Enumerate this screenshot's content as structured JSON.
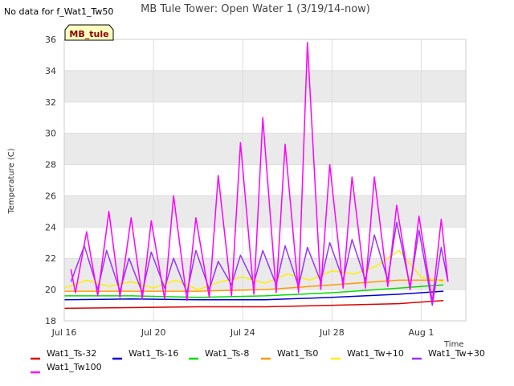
{
  "no_data_note": "No data for f_Wat1_Tw50",
  "badge_label": "MB_tule",
  "colors": {
    "band": "#eaeaea",
    "plot_bg": "#ffffff",
    "badge_fill": "#ffffc0"
  },
  "chart_data": {
    "type": "line",
    "title": "MB Tule Tower: Open Water 1 (3/19/14-now)",
    "xlabel": "Time",
    "ylabel": "Temperature (C)",
    "xlim": [
      "2014-07-16",
      "2014-08-03"
    ],
    "ylim": [
      18,
      36
    ],
    "y_ticks": [
      18,
      20,
      22,
      24,
      26,
      28,
      30,
      32,
      34,
      36
    ],
    "x_ticks": [
      {
        "date": "2014-07-16",
        "label": "Jul 16"
      },
      {
        "date": "2014-07-20",
        "label": "Jul 20"
      },
      {
        "date": "2014-07-24",
        "label": "Jul 24"
      },
      {
        "date": "2014-07-28",
        "label": "Jul 28"
      },
      {
        "date": "2014-08-01",
        "label": "Aug 1"
      }
    ],
    "grid": true,
    "legend_position": "bottom",
    "series": [
      {
        "name": "Wat1_Ts-32",
        "color": "#dd0000",
        "x": [
          "2014-07-16",
          "2014-07-19",
          "2014-07-22",
          "2014-07-25",
          "2014-07-28",
          "2014-07-31",
          "2014-08-02"
        ],
        "y": [
          18.8,
          18.85,
          18.9,
          18.9,
          19.0,
          19.1,
          19.3
        ]
      },
      {
        "name": "Wat1_Ts-16",
        "color": "#0000cc",
        "x": [
          "2014-07-16",
          "2014-07-19",
          "2014-07-22",
          "2014-07-25",
          "2014-07-28",
          "2014-07-31",
          "2014-08-02"
        ],
        "y": [
          19.35,
          19.4,
          19.35,
          19.35,
          19.5,
          19.7,
          19.9
        ]
      },
      {
        "name": "Wat1_Ts-8",
        "color": "#00dd00",
        "x": [
          "2014-07-16",
          "2014-07-19",
          "2014-07-22",
          "2014-07-25",
          "2014-07-28",
          "2014-07-31",
          "2014-08-02"
        ],
        "y": [
          19.6,
          19.6,
          19.5,
          19.6,
          19.8,
          20.1,
          20.3
        ]
      },
      {
        "name": "Wat1_Ts0",
        "color": "#ff9900",
        "x": [
          "2014-07-16",
          "2014-07-19",
          "2014-07-22",
          "2014-07-25",
          "2014-07-28",
          "2014-07-31",
          "2014-08-02"
        ],
        "y": [
          19.9,
          19.9,
          19.9,
          20.0,
          20.3,
          20.6,
          20.6
        ]
      },
      {
        "name": "Wat1_Tw+10",
        "color": "#ffee00",
        "x": [
          "2014-07-16",
          "2014-07-17",
          "2014-07-18",
          "2014-07-19",
          "2014-07-20",
          "2014-07-21",
          "2014-07-22",
          "2014-07-23",
          "2014-07-24",
          "2014-07-25",
          "2014-07-26",
          "2014-07-27",
          "2014-07-28",
          "2014-07-29",
          "2014-07-30",
          "2014-07-31",
          "2014-08-01",
          "2014-08-02"
        ],
        "y": [
          20.1,
          20.6,
          20.2,
          20.5,
          20.1,
          20.6,
          20.0,
          20.5,
          20.8,
          20.4,
          21.0,
          20.6,
          21.2,
          21.0,
          21.5,
          22.5,
          20.8,
          20.5
        ]
      },
      {
        "name": "Wat1_Tw+30",
        "color": "#9933ff",
        "x": [
          "2014-07-16.3",
          "2014-07-16.9",
          "2014-07-17.5",
          "2014-07-17.9",
          "2014-07-18.5",
          "2014-07-18.9",
          "2014-07-19.5",
          "2014-07-19.9",
          "2014-07-20.5",
          "2014-07-20.9",
          "2014-07-21.5",
          "2014-07-21.9",
          "2014-07-22.5",
          "2014-07-22.9",
          "2014-07-23.5",
          "2014-07-23.9",
          "2014-07-24.5",
          "2014-07-24.9",
          "2014-07-25.5",
          "2014-07-25.9",
          "2014-07-26.5",
          "2014-07-26.9",
          "2014-07-27.5",
          "2014-07-27.9",
          "2014-07-28.5",
          "2014-07-28.9",
          "2014-07-29.5",
          "2014-07-29.9",
          "2014-07-30.5",
          "2014-07-30.9",
          "2014-07-31.5",
          "2014-07-31.9",
          "2014-08-01.5",
          "2014-08-01.9",
          "2014-08-02.2"
        ],
        "y": [
          20.5,
          22.8,
          20.0,
          22.5,
          19.9,
          22.0,
          19.8,
          22.4,
          20.1,
          22.0,
          19.8,
          22.5,
          20.0,
          21.8,
          20.3,
          22.2,
          20.4,
          22.5,
          20.3,
          22.8,
          20.2,
          22.7,
          20.5,
          23.0,
          20.6,
          23.2,
          20.6,
          23.5,
          20.6,
          24.3,
          20.2,
          23.8,
          19.0,
          22.7,
          20.5
        ]
      },
      {
        "name": "Wat1_Tw100",
        "color": "#ff00ff",
        "x": [
          "2014-07-16.3",
          "2014-07-16.5",
          "2014-07-17.0",
          "2014-07-17.5",
          "2014-07-18.0",
          "2014-07-18.5",
          "2014-07-19.0",
          "2014-07-19.5",
          "2014-07-19.9",
          "2014-07-20.5",
          "2014-07-20.9",
          "2014-07-21.5",
          "2014-07-21.9",
          "2014-07-22.5",
          "2014-07-22.9",
          "2014-07-23.5",
          "2014-07-23.9",
          "2014-07-24.5",
          "2014-07-24.9",
          "2014-07-25.5",
          "2014-07-25.9",
          "2014-07-26.5",
          "2014-07-26.9",
          "2014-07-27.5",
          "2014-07-27.9",
          "2014-07-28.5",
          "2014-07-28.9",
          "2014-07-29.5",
          "2014-07-29.9",
          "2014-07-30.5",
          "2014-07-30.9",
          "2014-07-31.5",
          "2014-07-31.9",
          "2014-08-01.5",
          "2014-08-01.9",
          "2014-08-02.2"
        ],
        "y": [
          21.3,
          19.8,
          23.7,
          19.6,
          25.0,
          19.5,
          24.6,
          19.4,
          24.4,
          19.4,
          26.0,
          19.3,
          24.6,
          19.5,
          27.3,
          19.6,
          29.4,
          19.7,
          31.0,
          19.8,
          29.3,
          19.8,
          35.8,
          20.0,
          28.0,
          20.1,
          27.2,
          20.1,
          27.2,
          20.2,
          25.4,
          20.0,
          24.7,
          19.2,
          24.5,
          20.5
        ]
      }
    ]
  }
}
